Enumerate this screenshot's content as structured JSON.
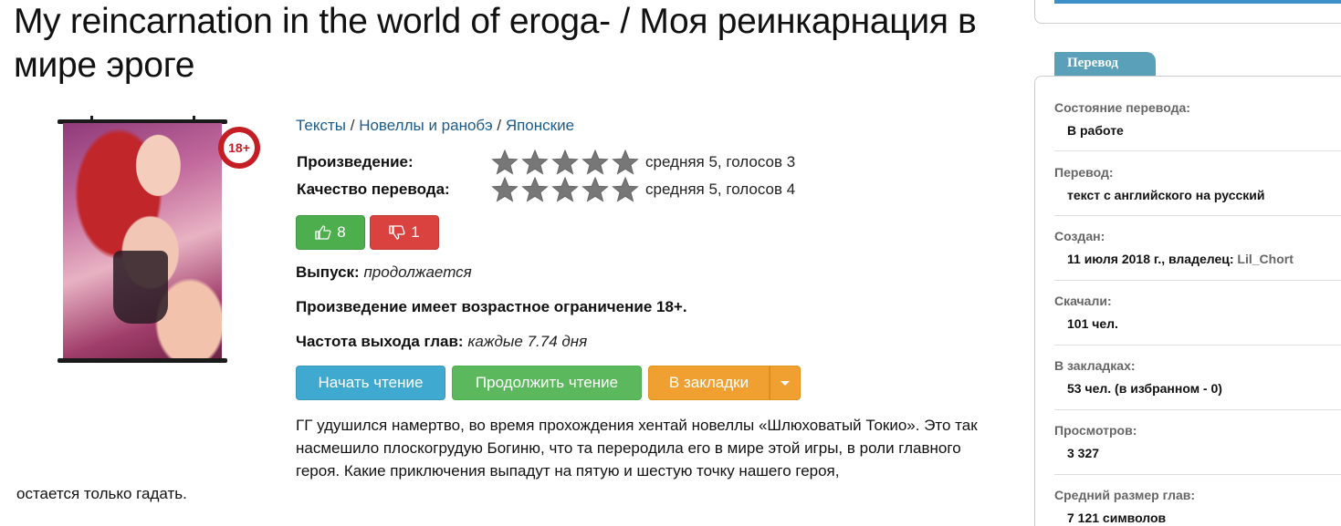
{
  "title": "My reincarnation in the world of eroga- / Моя реинкарнация в мире эроге",
  "age_badge": "18+",
  "breadcrumbs": [
    "Тексты",
    "Новеллы и ранобэ",
    "Японские"
  ],
  "breadcrumb_sep": " / ",
  "ratings": [
    {
      "label": "Произведение:",
      "score": "средняя 5, голосов 3",
      "stars": 5
    },
    {
      "label": "Качество перевода:",
      "score": "средняя 5, голосов 4",
      "stars": 5
    }
  ],
  "votes": {
    "up": "8",
    "down": "1"
  },
  "release": {
    "label": "Выпуск:",
    "value": "продолжается"
  },
  "age_notice": "Произведение имеет возрастное ограничение 18+.",
  "frequency": {
    "label": "Частота выхода глав:",
    "value": "каждые 7.74 дня"
  },
  "buttons": {
    "start": "Начать чтение",
    "continue": "Продолжить чтение",
    "bookmark": "В закладки"
  },
  "description": "ГГ удушился намертво, во время прохождения хентай новеллы «Шлюховатый Токио». Это так насмешило плоскогрудую Богиню, что та переродила его в мире этой игры, в роли главного героя. Какие приключения выпадут на пятую и шестую точку нашего героя,",
  "description_tail": "остается только гадать.",
  "sidebar": {
    "tab": "Перевод",
    "items": [
      {
        "key": "Состояние перевода:",
        "value": "В работе"
      },
      {
        "key": "Перевод:",
        "value": "текст с английского на русский"
      },
      {
        "key": "Создан:",
        "value": "11 июля 2018 г., владелец:",
        "owner": "Lil_Chort"
      },
      {
        "key": "Скачали:",
        "value": "101 чел."
      },
      {
        "key": "В закладках:",
        "value": "53 чел. (в избранном - 0)"
      },
      {
        "key": "Просмотров:",
        "value": "3 327"
      },
      {
        "key": "Средний размер глав:",
        "value": "7 121 символов"
      }
    ]
  },
  "colors": {
    "link": "#1b5b8a",
    "vote_up": "#4cae4c",
    "vote_down": "#d9423e",
    "btn_start": "#3fa9cf",
    "btn_continue": "#5cb85c",
    "btn_bookmark": "#f0a030",
    "tab": "#5aa0b8"
  }
}
